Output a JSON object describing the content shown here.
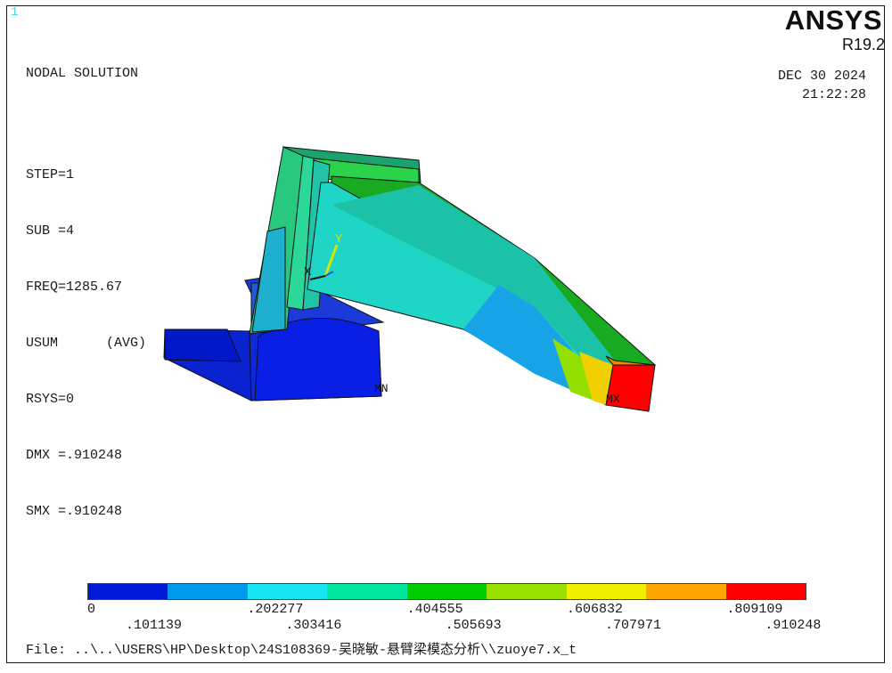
{
  "window_number": "1",
  "header": {
    "title": "NODAL SOLUTION",
    "step": "STEP=1",
    "sub": "SUB =4",
    "freq": "FREQ=1285.67",
    "usum": "USUM      (AVG)",
    "rsys": "RSYS=0",
    "dmx": "DMX =.910248",
    "smx": "SMX =.910248"
  },
  "brand": {
    "name": "ANSYS",
    "release": "R19.2",
    "date": "DEC 30 2024",
    "time": "21:22:28"
  },
  "model_labels": {
    "axis_x": "X",
    "axis_y": "Y",
    "min_marker": "MN",
    "max_marker": "MX"
  },
  "legend": {
    "colors": [
      "#0019d6",
      "#0099ee",
      "#19e6f2",
      "#00e6a0",
      "#00cc00",
      "#99e000",
      "#f0f000",
      "#ffa500",
      "#ff0000"
    ],
    "labels_top": [
      "0",
      ".202277",
      ".404555",
      ".606832",
      ".809109"
    ],
    "labels_bottom": [
      ".101139",
      ".303416",
      ".505693",
      ".707971",
      ".910248"
    ]
  },
  "footer": {
    "file": "File: ..\\..\\USERS\\HP\\Desktop\\24S108369-吴晓敏-悬臂梁模态分析\\\\zuoye7.x_t"
  }
}
